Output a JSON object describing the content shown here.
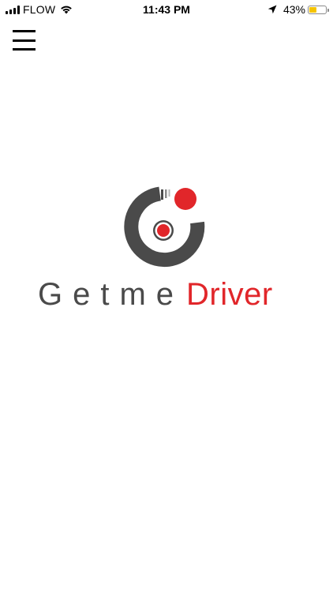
{
  "status_bar": {
    "carrier": "FLOW",
    "time": "11:43 PM",
    "battery_percent": "43%",
    "battery_level": 0.43,
    "battery_color": "#f5c400",
    "icons": [
      "signal-bars-icon",
      "wifi-icon",
      "location-arrow-icon",
      "battery-icon"
    ]
  },
  "nav": {
    "menu_icon": "hamburger-menu-icon"
  },
  "logo": {
    "word_1": "Getme",
    "word_2": "Driver",
    "colors": {
      "gray": "#4a4a4a",
      "red": "#e1262a"
    }
  }
}
